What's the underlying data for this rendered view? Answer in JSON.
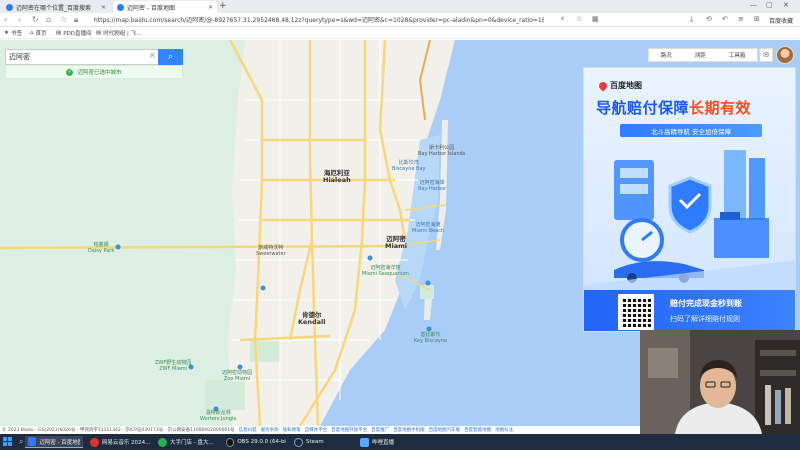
{
  "browser": {
    "tabs": [
      {
        "label": "迈阿密在哪个位置_百度搜索",
        "active": false
      },
      {
        "label": "迈阿密 - 百度地图",
        "active": true
      }
    ],
    "url": "https://map.baidu.com/search/迈阿密/@-8927657.31,2952468.48,12z?querytype=s&wd=迈阿密&c=1028&provider=pc-aladin&pn=0&device_ratio=1&da_src",
    "extension_label": "百度收藏",
    "bookmarks": [
      "书签",
      "首页",
      "PDD直播间",
      "时代剧组 | 飞..."
    ],
    "window_controls": [
      "—",
      "▢",
      "✕"
    ]
  },
  "search": {
    "value": "迈阿密",
    "button_icon": "search-icon",
    "suggestion": "迈阿密已选中城市"
  },
  "toolbar": {
    "items": [
      "路况",
      "测距",
      "工具箱"
    ],
    "message_icon": "message-icon"
  },
  "map": {
    "places": [
      {
        "name": "海厄利亚\nHialeah",
        "style": "big"
      },
      {
        "name": "迈阿密\nMiami",
        "style": "big"
      },
      {
        "name": "斯威特沃特\nSweetwater",
        "style": "normal"
      },
      {
        "name": "肯德尔\nKendall",
        "style": "big"
      },
      {
        "name": "比斯坎湾\nBiscayne Bay",
        "style": "water"
      },
      {
        "name": "迈阿密海滩\nMiami Beach",
        "style": "water"
      },
      {
        "name": "迈阿密动物园\nZoo Miami",
        "style": "green"
      },
      {
        "name": "帕塞姆\nDaisy Park",
        "style": "green"
      },
      {
        "name": "ZWF野生动物园\nZWF Miami",
        "style": "green"
      },
      {
        "name": "温特斯丛林\nWorters Jungle",
        "style": "green"
      },
      {
        "name": "迈阿密海洋馆\nMiami Seaquarium",
        "style": "green"
      },
      {
        "name": "基比斯坎\nKey Biscayne",
        "style": "green"
      },
      {
        "name": "斯卡利公园\nBay Harbor Islands",
        "style": "normal"
      },
      {
        "name": "迈阿密海岸\nBay Harbor",
        "style": "water"
      }
    ]
  },
  "ad": {
    "brand": "百度地图",
    "headline_main": "导航赔付保障",
    "headline_highlight": "长期有效",
    "subline": "北斗高精导航 安全加倍保障",
    "footer_title": "赔付完成现金秒到账",
    "footer_sub": "扫码了解详细赔付规则",
    "colors": {
      "primary": "#1a56ff",
      "highlight": "#ff4a1a"
    }
  },
  "footer": {
    "copyright": "© 2023 Baidu - GS(2021)6026号 - 甲测资字11111342 - 京ICP证030173号 - 京公网安备11000002000001号",
    "links": [
      "信息纠错",
      "服务条款",
      "隐私政策",
      "自媒体平台",
      "百度地图开放平台",
      "百度推广",
      "百度地图手机版",
      "百度地图汽车版",
      "百度智能地图",
      "地图标注"
    ]
  },
  "taskbar": {
    "items": [
      {
        "label": "迈阿密 - 百度地图",
        "color": "#3478f6",
        "active": true
      },
      {
        "label": "网易云音乐 2024...",
        "color": "#e0322c",
        "active": false
      },
      {
        "label": "大手门店 - 盘大...",
        "color": "#2bb24c",
        "active": false
      },
      {
        "label": "OBS 29.0.0 (64-bi...",
        "color": "#111111",
        "active": false
      },
      {
        "label": "Steam",
        "color": "#1b2838",
        "active": false
      },
      {
        "label": "哔哩直播",
        "color": "#5aa6ff",
        "active": false
      }
    ]
  }
}
